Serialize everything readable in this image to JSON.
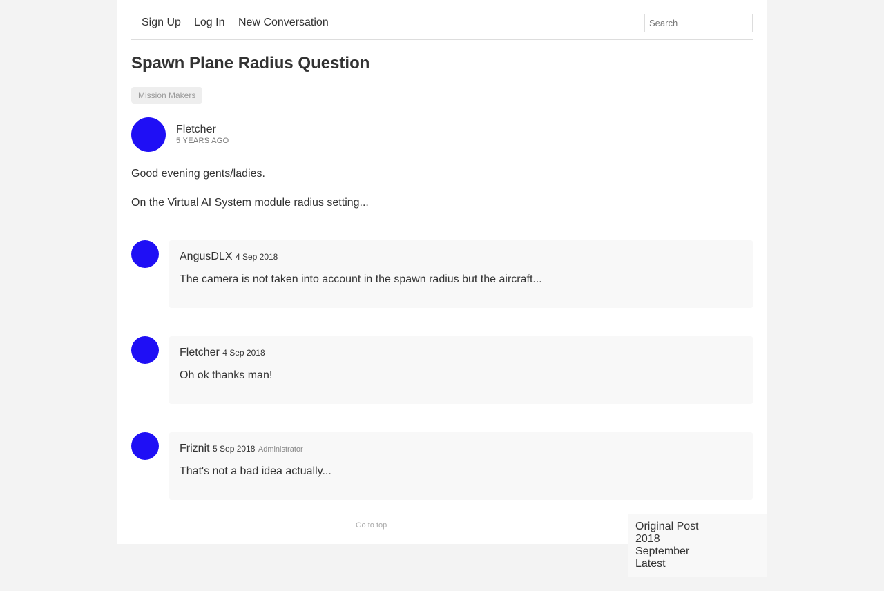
{
  "nav": {
    "sign_up": "Sign Up",
    "log_in": "Log In",
    "new_conversation": "New Conversation",
    "search_placeholder": "Search"
  },
  "thread": {
    "title": "Spawn Plane Radius Question",
    "tag": "Mission Makers"
  },
  "original_post": {
    "author": "Fletcher",
    "time": "5 YEARS AGO",
    "paragraphs": [
      "Good evening gents/ladies.",
      "On the Virtual AI System module radius setting..."
    ]
  },
  "replies": [
    {
      "author": "AngusDLX",
      "date": "4 Sep 2018",
      "role": "",
      "text": "The camera is not taken into account in the spawn radius but the aircraft..."
    },
    {
      "author": "Fletcher",
      "date": "4 Sep 2018",
      "role": "",
      "text": "Oh ok thanks man!"
    },
    {
      "author": "Friznit",
      "date": "5 Sep 2018",
      "role": "Administrator",
      "text": "That's not a bad idea actually..."
    }
  ],
  "footer": {
    "go_to_top": "Go to top"
  },
  "scrubber": {
    "original_post": "Original Post",
    "year": "2018",
    "month": "September",
    "latest": "Latest"
  },
  "colors": {
    "avatar": "#1f0ff5",
    "page_bg": "#f3f3f3",
    "content_bg": "#ffffff"
  }
}
